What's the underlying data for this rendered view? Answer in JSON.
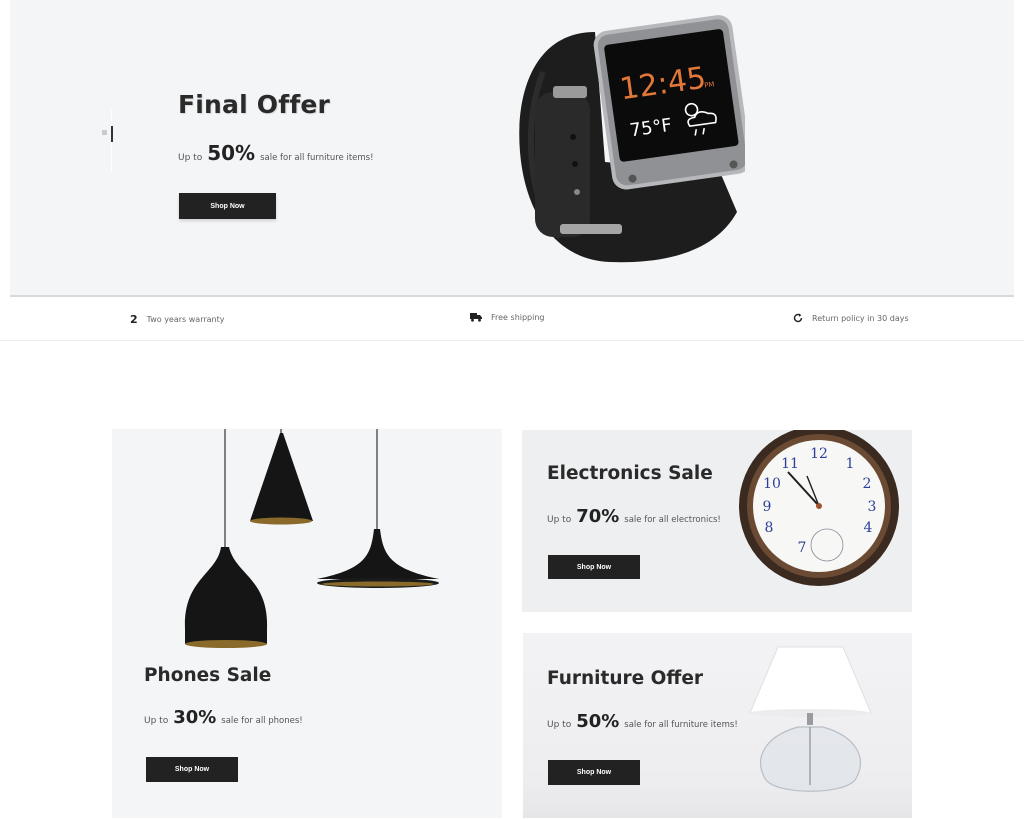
{
  "hero": {
    "title": "Final Offer",
    "up_to": "Up to",
    "percent": "50%",
    "subtitle": "sale for all furniture items!",
    "button": "Shop Now",
    "watch_time": "12:45",
    "watch_ampm": "PM",
    "watch_temp": "75°F"
  },
  "features": [
    {
      "icon": "2",
      "icon_name": "warranty-icon",
      "label": "Two years warranty"
    },
    {
      "icon": "truck",
      "icon_name": "truck-icon",
      "label": "Free shipping"
    },
    {
      "icon": "refresh",
      "icon_name": "refresh-icon",
      "label": "Return policy in 30 days"
    }
  ],
  "cards": [
    {
      "title": "Phones Sale",
      "up_to": "Up to",
      "percent": "30%",
      "subtitle": "sale for all phones!",
      "button": "Shop Now"
    },
    {
      "title": "Electronics Sale",
      "up_to": "Up to",
      "percent": "70%",
      "subtitle": "sale for all electronics!",
      "button": "Shop Now"
    },
    {
      "title": "Furniture Offer",
      "up_to": "Up to",
      "percent": "50%",
      "subtitle": "sale for all furniture items!",
      "button": "Shop Now"
    }
  ],
  "colors": {
    "hero_bg": "#f4f5f7",
    "button_bg": "#222222",
    "accent_orange": "#e2773a"
  }
}
